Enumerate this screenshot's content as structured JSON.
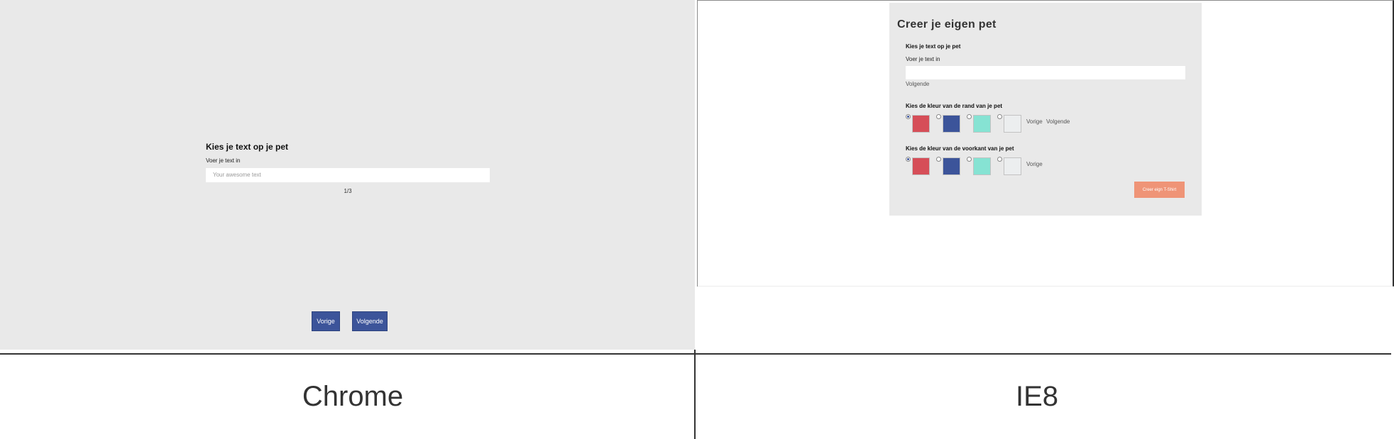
{
  "chrome": {
    "step_title": "Kies je text op je pet",
    "field_label": "Voer je text in",
    "input_placeholder": "Your awesome text",
    "input_value": "",
    "step_counter": "1/3",
    "prev_button": "Vorige",
    "next_button": "Volgende",
    "button_color": "#3c549a",
    "background_color": "#e9e9e9"
  },
  "ie": {
    "heading": "Creer je eigen pet",
    "step1": {
      "title": "Kies je text op je pet",
      "field_label": "Voer je text in",
      "input_value": "",
      "next_link": "Volgende"
    },
    "step2": {
      "title": "Kies de kleur van de rand van je pet",
      "selected_index": 0,
      "swatches": [
        "#d64e58",
        "#3c549a",
        "#86e3d3",
        "#eceeef"
      ],
      "prev_link": "Vorige",
      "next_link": "Volgende"
    },
    "step3": {
      "title": "Kies de kleur van de voorkant van je pet",
      "selected_index": 0,
      "swatches": [
        "#d64e58",
        "#3c549a",
        "#86e3d3",
        "#eceeef"
      ],
      "prev_link": "Vorige"
    },
    "create_button": "Creer eign T-Shirt",
    "create_button_color": "#ef9477"
  },
  "captions": {
    "left": "Chrome",
    "right": "IE8"
  }
}
